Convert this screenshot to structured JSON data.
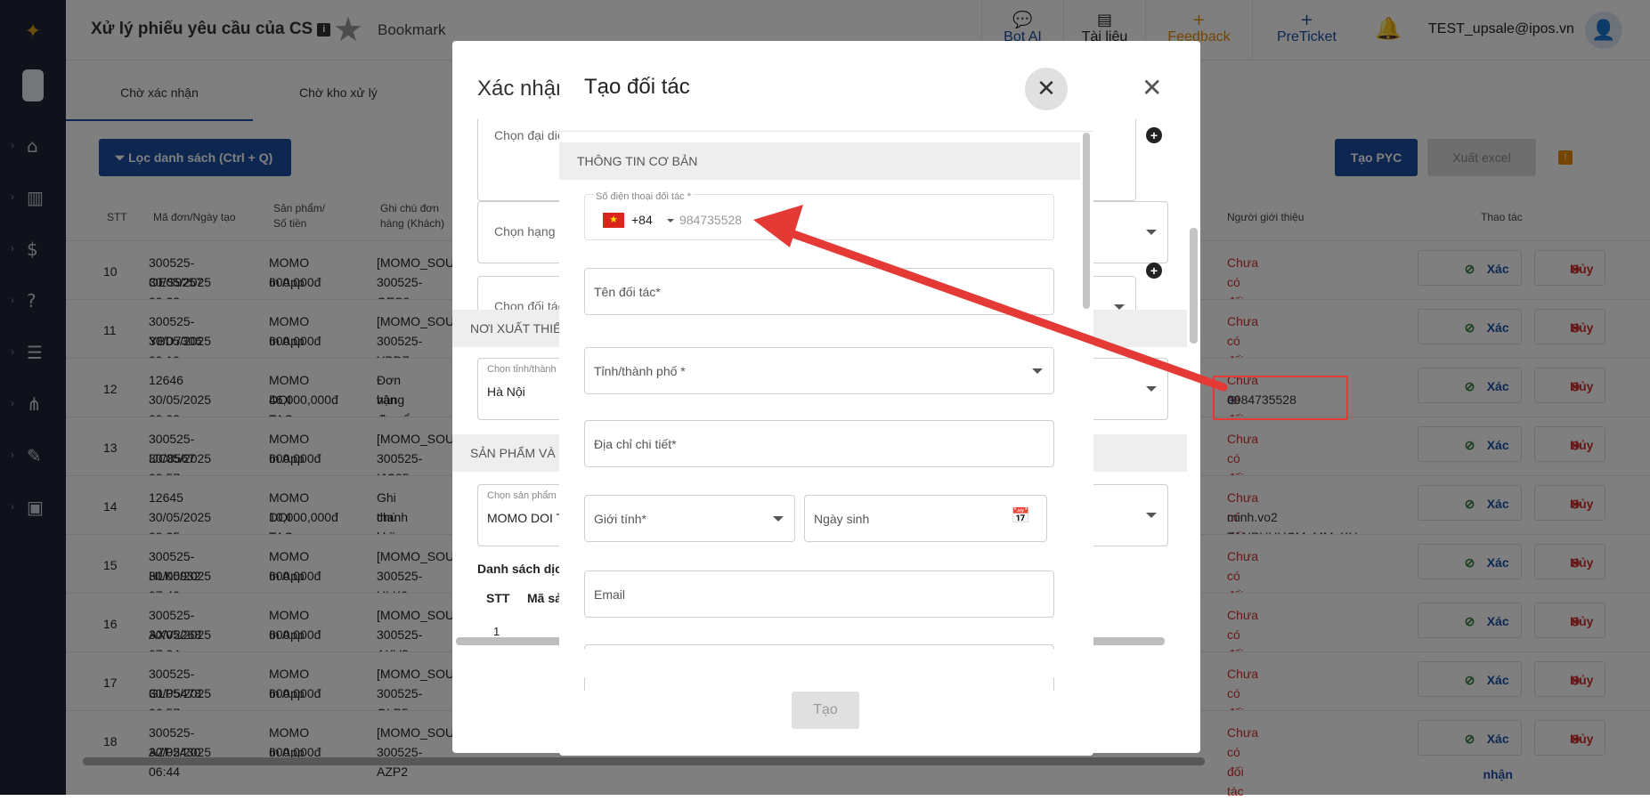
{
  "header": {
    "title": "Xử lý phiếu yêu cầu của CS",
    "info_icon": "i",
    "bookmark": "Bookmark",
    "bot_ai": "Bot AI",
    "tai_lieu": "Tài liệu",
    "feedback": "Feedback",
    "preticket": "PreTicket",
    "user_email": "TEST_upsale@ipos.vn"
  },
  "tabs": [
    "Chờ xác nhận",
    "Chờ kho xử lý"
  ],
  "toolbar": {
    "filter_label": "Lọc danh sách (Ctrl + Q)",
    "create_label": "Tạo PYC",
    "export_label": "Xuất excel"
  },
  "table": {
    "headers": {
      "stt": "STT",
      "ma_don": "Mã đơn/Ngày tạo",
      "san_pham_1": "Sản phẩm/",
      "san_pham_2": "Số tiền",
      "ghi_chu_1": "Ghi chú đơn",
      "ghi_chu_2": "hàng (Khách)",
      "gioi_thieu": "Người giới thiệu",
      "thao_tac": "Thao tác"
    },
    "rows": [
      {
        "stt": "10",
        "code": "300525-OES9257",
        "date": "30/05/2025 09:33",
        "product": "MOMO In App",
        "amount": "600,000đ",
        "note1": "[MOMO_SOU",
        "note2": "300525-OES9",
        "ref": "Chưa có đối tác",
        "ref2": ""
      },
      {
        "stt": "11",
        "code": "300525-YBD7306",
        "date": "30/05/2025 09:19",
        "product": "MOMO In App",
        "amount": "600,000đ",
        "note1": "[MOMO_SOU",
        "note2": "300525-YBD7",
        "ref": "Chưa có đối tác",
        "ref2": ""
      },
      {
        "stt": "12",
        "code": "12646",
        "date": "30/05/2025 09:03",
        "product": "MOMO DOI TAC",
        "amount": "46,000,000đ",
        "note1": "Đơn hàng đư",
        "note2": "vận chuyển v",
        "ref": "Chưa có đối tác",
        "ref2": "0984735528"
      },
      {
        "stt": "13",
        "code": "300525-IJC8567",
        "date": "30/05/2025 08:57",
        "product": "MOMO In App",
        "amount": "600,000đ",
        "note1": "[MOMO_SOU",
        "note2": "300525-IJC85",
        "ref": "Chưa có đối tác",
        "ref2": ""
      },
      {
        "stt": "14",
        "code": "12645",
        "date": "30/05/2025 08:35",
        "product": "MOMO DOI TAC",
        "amount": "10,000,000đ",
        "note1": "Ghi chú khác",
        "note2": "thanh toán và",
        "ref": "Chưa có đối tác",
        "ref2": "minh.vo2 TANPHUHCM_MM_KH"
      },
      {
        "stt": "15",
        "code": "300525-HLK0932",
        "date": "30/05/2025 07:40",
        "product": "MOMO In App",
        "amount": "600,000đ",
        "note1": "[MOMO_SOU",
        "note2": "300525-HLK0",
        "ref": "Chưa có đối tác",
        "ref2": ""
      },
      {
        "stt": "16",
        "code": "300525-AXV2268",
        "date": "30/05/2025 07:24",
        "product": "MOMO In App",
        "amount": "600,000đ",
        "note1": "[MOMO_SOU",
        "note2": "300525-AXV2",
        "ref": "Chưa có đối tác",
        "ref2": ""
      },
      {
        "stt": "17",
        "code": "300525-GLP5478",
        "date": "30/05/2025 06:57",
        "product": "MOMO In App",
        "amount": "600,000đ",
        "note1": "[MOMO_SOU",
        "note2": "300525-GLP5",
        "ref": "Chưa có đối tác",
        "ref2": ""
      },
      {
        "stt": "18",
        "code": "300525-AZP2430",
        "date": "30/05/2025 06:44",
        "product": "MOMO In App",
        "amount": "600,000đ",
        "note1": "[MOMO_SOU",
        "note2": "300525-AZP2",
        "ref": "Chưa có đối tác",
        "ref2": ""
      }
    ],
    "confirm_label": "Xác nhận",
    "cancel_label": "Hủy"
  },
  "modal_confirm": {
    "title": "Xác nhận",
    "dai_dien_placeholder": "Chọn đại diệ",
    "hang_placeholder": "Chọn hạng đ",
    "doi_tac_placeholder": "Chọn đối tác",
    "section_noi_xuat": "NƠI XUẤT THIẾ",
    "tinh_label": "Chọn tỉnh/thành p",
    "tinh_value": "Hà Nội",
    "section_san_pham": "SẢN PHẨM VÀ",
    "sp_label": "Chọn sản phẩm *",
    "sp_value": "MOMO DOI T",
    "danh_sach": "Danh sách dịch",
    "col_stt": "STT",
    "col_ma": "Mã sả",
    "row1": "1"
  },
  "modal_partner": {
    "title": "Tạo đối tác",
    "section": "THÔNG TIN CƠ BẢN",
    "phone_label": "Số điện thoại đối tác *",
    "country_code": "+84",
    "phone_placeholder": "984735528",
    "name_label": "Tên đối tác*",
    "city_label": "Tỉnh/thành phố *",
    "address_label": "Địa chỉ chi tiết*",
    "gender_label": "Giới tính*",
    "birthday_label": "Ngày sinh",
    "email_label": "Email",
    "submit_label": "Tạo"
  },
  "colors": {
    "primary": "#1b4fa0",
    "danger": "#d32f2f",
    "success": "#2e7d32",
    "sidebar": "#1e2535",
    "annotation": "#e53935"
  }
}
